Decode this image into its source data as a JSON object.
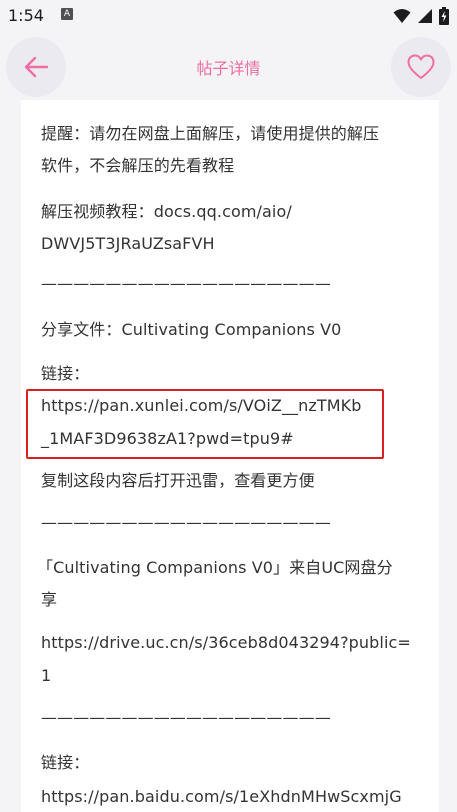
{
  "status_bar": {
    "time": "1:54",
    "notification_letter": "A",
    "icons": [
      "wifi-icon",
      "signal-icon",
      "battery-icon"
    ]
  },
  "header": {
    "title": "帖子详情",
    "back_icon": "arrow-left-icon",
    "favorite_icon": "heart-outline-icon",
    "accent_color": "#f06ea3"
  },
  "content": {
    "lines": [
      "提醒：请勿在网盘上面解压，请使用提供的解压",
      "软件，不会解压的先看教程",
      "解压视频教程：docs.qq.com/aio/",
      "DWVJ5T3JRaUZsaFVH",
      "——————————————————",
      "分享文件：Cultivating Companions V0",
      "链接：",
      "https://pan.xunlei.com/s/VOiZ__nzTMKb",
      "_1MAF3D9638zA1?pwd=tpu9#",
      "复制这段内容后打开迅雷，查看更方便",
      "——————————————————",
      "「Cultivating Companions V0」来自UC网盘分",
      "享",
      "https://drive.uc.cn/s/36ceb8d043294?public=",
      "1",
      "——————————————————",
      "链接：",
      "https://pan.baidu.com/s/1eXhdnMHwScxmjG"
    ],
    "highlight_color": "#d9201f"
  }
}
